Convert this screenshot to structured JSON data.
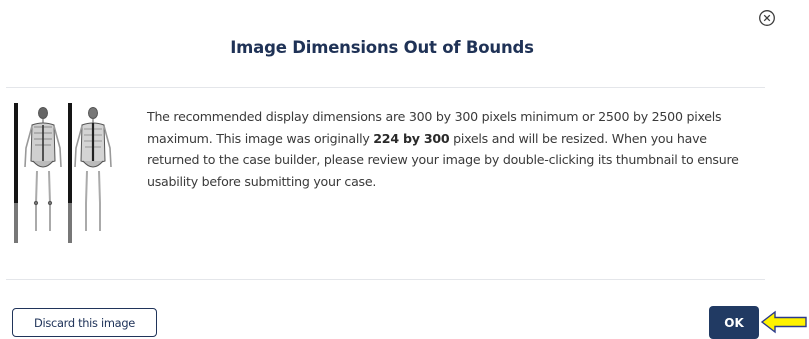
{
  "dialog": {
    "title": "Image Dimensions Out of Bounds",
    "close_icon": "circle-x-icon",
    "message": {
      "part1": "The recommended display dimensions are 300 by 300 pixels minimum or 2500 by 2500 pixels maximum. This image was originally ",
      "bold": "224 by 300",
      "part2": " pixels and will be resized. When you have returned to the case builder, please review your image by double-clicking its thumbnail to ensure usability before submitting your case."
    },
    "thumbnail_icon": "bone-scan-thumbnail",
    "discard_label": "Discard this image",
    "ok_label": "OK",
    "pointer_icon": "left-arrow-icon"
  },
  "colors": {
    "title": "#1f3256",
    "primary_button": "#213a63",
    "arrow_fill": "#fff200",
    "arrow_stroke": "#2b3a8c",
    "divider": "#e4e6ea"
  }
}
